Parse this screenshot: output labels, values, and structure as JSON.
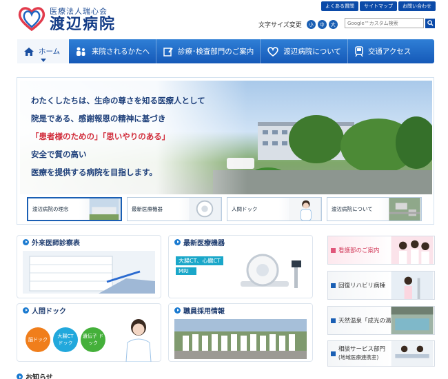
{
  "header": {
    "logo_sub": "医療法人瑞心会",
    "logo_main": "渡辺病院",
    "top_links": [
      "よくある質問",
      "サイトマップ",
      "お問い合わせ"
    ],
    "font_size_label": "文字サイズ変更",
    "font_size_options": [
      "小",
      "中",
      "大"
    ],
    "search_placeholder": "Google™カスタム検索"
  },
  "nav": [
    {
      "label": "ホーム",
      "icon": "home-icon",
      "active": true
    },
    {
      "label": "来院されるかたへ",
      "icon": "people-icon"
    },
    {
      "label": "診療･検査部門のご案内",
      "icon": "clipboard-icon"
    },
    {
      "label": "渡辺病院について",
      "icon": "heart-icon"
    },
    {
      "label": "交通アクセス",
      "icon": "train-icon"
    }
  ],
  "hero": {
    "lines": [
      "わたくしたちは、生命の尊さを知る医療人として",
      "院是である、感謝報恩の精神に基づき",
      "「患者様のための」「思いやりのある」",
      "安全で質の高い",
      "医療を提供する病院を目指します。"
    ],
    "thumbs": [
      "渡辺病院の理念",
      "最新医療機器",
      "人間ドック",
      "渡辺病院について"
    ]
  },
  "cards": {
    "outpatient": {
      "title": "外来医師診察表"
    },
    "equipment": {
      "title": "最新医療機器",
      "tags": [
        "大腸CT、心臓CT",
        "MRI"
      ]
    },
    "dock": {
      "title": "人間ドック",
      "bubbles": [
        "脳ドック",
        "大腸CT ドック",
        "遺伝子 ドック"
      ]
    },
    "recruit": {
      "title": "職員採用情報"
    }
  },
  "side_buttons": [
    {
      "label": "看護部のご案内"
    },
    {
      "label": "回復リハビリ病棟"
    },
    {
      "label": "天然温泉「成光の湯」"
    },
    {
      "label": "相談サービス部門",
      "sub": "(地域医療連携室)"
    }
  ],
  "news_title": "お知らせ",
  "colors": {
    "brand_blue": "#1559b8",
    "accent_red": "#d12b3a",
    "accent_pink": "#e0567a"
  }
}
